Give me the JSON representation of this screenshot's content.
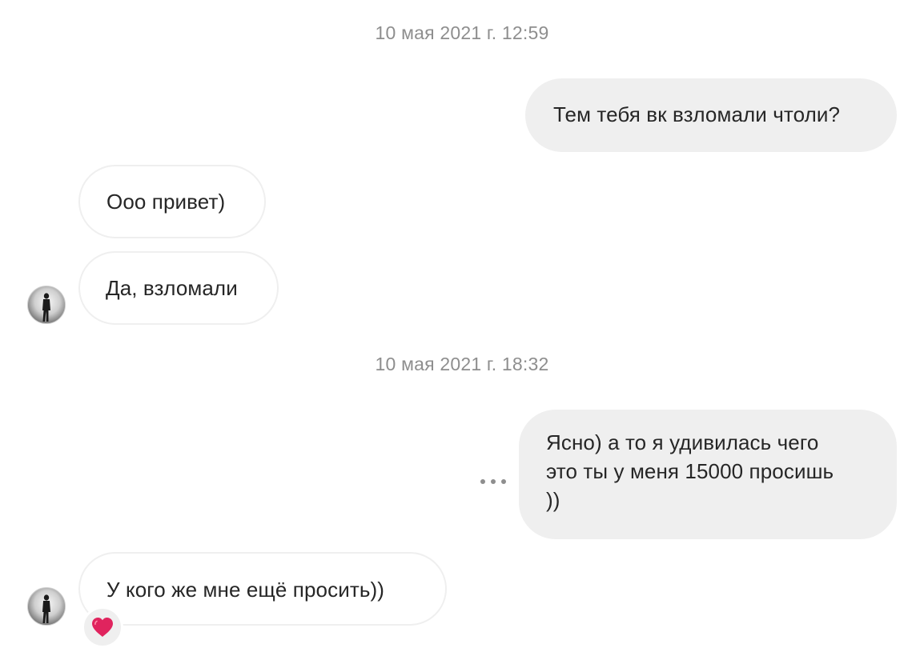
{
  "thread": {
    "timestamps": [
      "10 мая 2021 г. 12:59",
      "10 мая 2021 г. 18:32"
    ],
    "messages": [
      {
        "direction": "outgoing",
        "text": "Тем тебя вк взломали чтоли?"
      },
      {
        "direction": "incoming",
        "text": "Ооо привет)"
      },
      {
        "direction": "incoming",
        "text": "Да, взломали"
      },
      {
        "direction": "outgoing",
        "lines": [
          "Ясно) а то я удивилась чего",
          "это ты у меня 15000 просишь",
          "))"
        ]
      },
      {
        "direction": "incoming",
        "text": "У кого же мне ещё просить))",
        "reaction": "❤️"
      }
    ]
  },
  "colors": {
    "outgoing_bubble": "#efefef",
    "incoming_border": "#efefef",
    "timestamp_text": "#8e8e8e",
    "reaction_heart": "#e0245e"
  },
  "icons": {
    "avatar": "contact-avatar-silhouette",
    "more": "more-options-icon",
    "reaction": "heart-reaction-icon"
  }
}
